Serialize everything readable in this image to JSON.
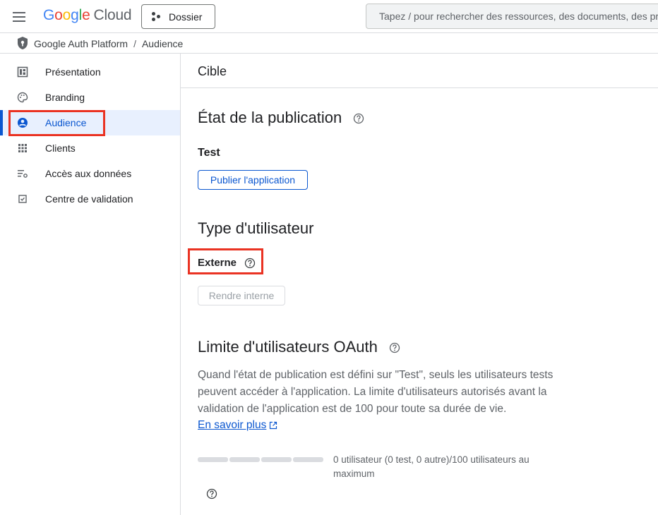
{
  "header": {
    "logo_google": "Google",
    "logo_cloud": "Cloud",
    "project_label": "Dossier",
    "search_placeholder": "Tapez / pour rechercher des ressources, des documents, des pro"
  },
  "breadcrumb": {
    "product": "Google Auth Platform",
    "separator": "/",
    "page": "Audience"
  },
  "sidebar": {
    "items": [
      {
        "label": "Présentation",
        "icon": "dashboard-icon"
      },
      {
        "label": "Branding",
        "icon": "palette-icon"
      },
      {
        "label": "Audience",
        "icon": "person-circle-icon",
        "active": true
      },
      {
        "label": "Clients",
        "icon": "grid-icon"
      },
      {
        "label": "Accès aux données",
        "icon": "data-access-icon"
      },
      {
        "label": "Centre de validation",
        "icon": "checkbox-icon"
      }
    ]
  },
  "main": {
    "title": "Cible",
    "publishing": {
      "heading": "État de la publication",
      "status": "Test",
      "button": "Publier l'application"
    },
    "user_type": {
      "heading": "Type d'utilisateur",
      "value": "Externe",
      "button": "Rendre interne"
    },
    "oauth_limit": {
      "heading": "Limite d'utilisateurs OAuth",
      "description": "Quand l'état de publication est défini sur \"Test\", seuls les utilisateurs tests peuvent accéder à l'application. La limite d'utilisateurs autorisés avant la validation de l'application est de 100 pour toute sa durée de vie.",
      "link": "En savoir plus",
      "usage": "0 utilisateur (0 test, 0 autre)/100 utilisateurs au maximum",
      "progress_fraction": 0
    }
  },
  "colors": {
    "accent": "#0b57d0",
    "highlight_box": "#ea3323",
    "active_bg": "#e8f0fe"
  }
}
